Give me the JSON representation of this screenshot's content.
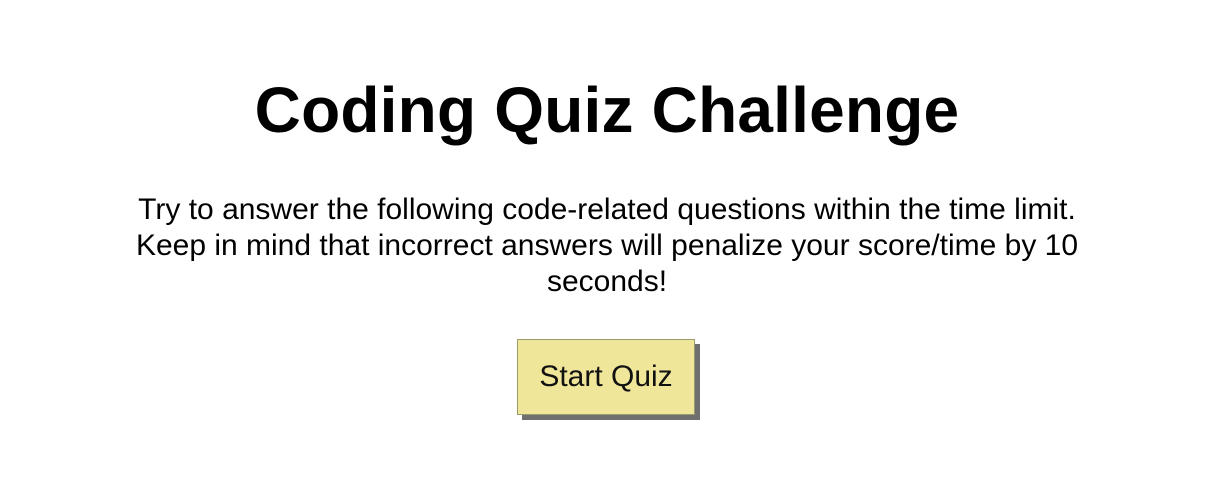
{
  "quiz": {
    "title": "Coding Quiz Challenge",
    "description": "Try to answer the following code-related questions within the time limit. Keep in mind that incorrect answers will penalize your score/time by 10 seconds!",
    "start_button_label": "Start Quiz"
  },
  "colors": {
    "background": "#ffffff",
    "text": "#000000",
    "button_fill": "#f0e69a",
    "button_shadow": "#6f6f6f"
  }
}
